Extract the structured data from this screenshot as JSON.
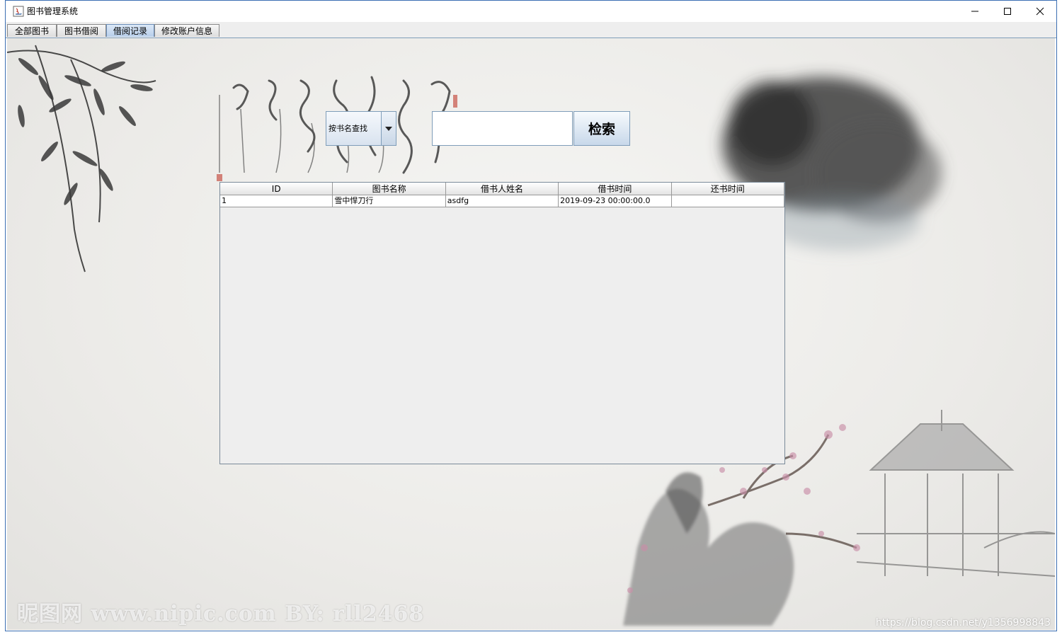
{
  "window": {
    "title": "图书管理系统"
  },
  "tabs": [
    {
      "label": "全部图书"
    },
    {
      "label": "图书借阅"
    },
    {
      "label": "借阅记录",
      "active": true
    },
    {
      "label": "修改账户信息"
    }
  ],
  "search": {
    "mode_selected": "按书名查找",
    "input_value": "",
    "button_label": "检索"
  },
  "table": {
    "columns": [
      "ID",
      "图书名称",
      "借书人姓名",
      "借书时间",
      "还书时间"
    ],
    "rows": [
      [
        "1",
        "雪中悍刀行",
        "asdfg",
        "2019-09-23 00:00:00.0",
        ""
      ]
    ]
  },
  "watermarks": {
    "left": "昵图网 www.nipic.com  BY: rll2468",
    "right": "https://blog.csdn.net/y1356998843"
  },
  "colors": {
    "window_border": "#3c6fb3",
    "active_tab": "#b8cfea"
  }
}
